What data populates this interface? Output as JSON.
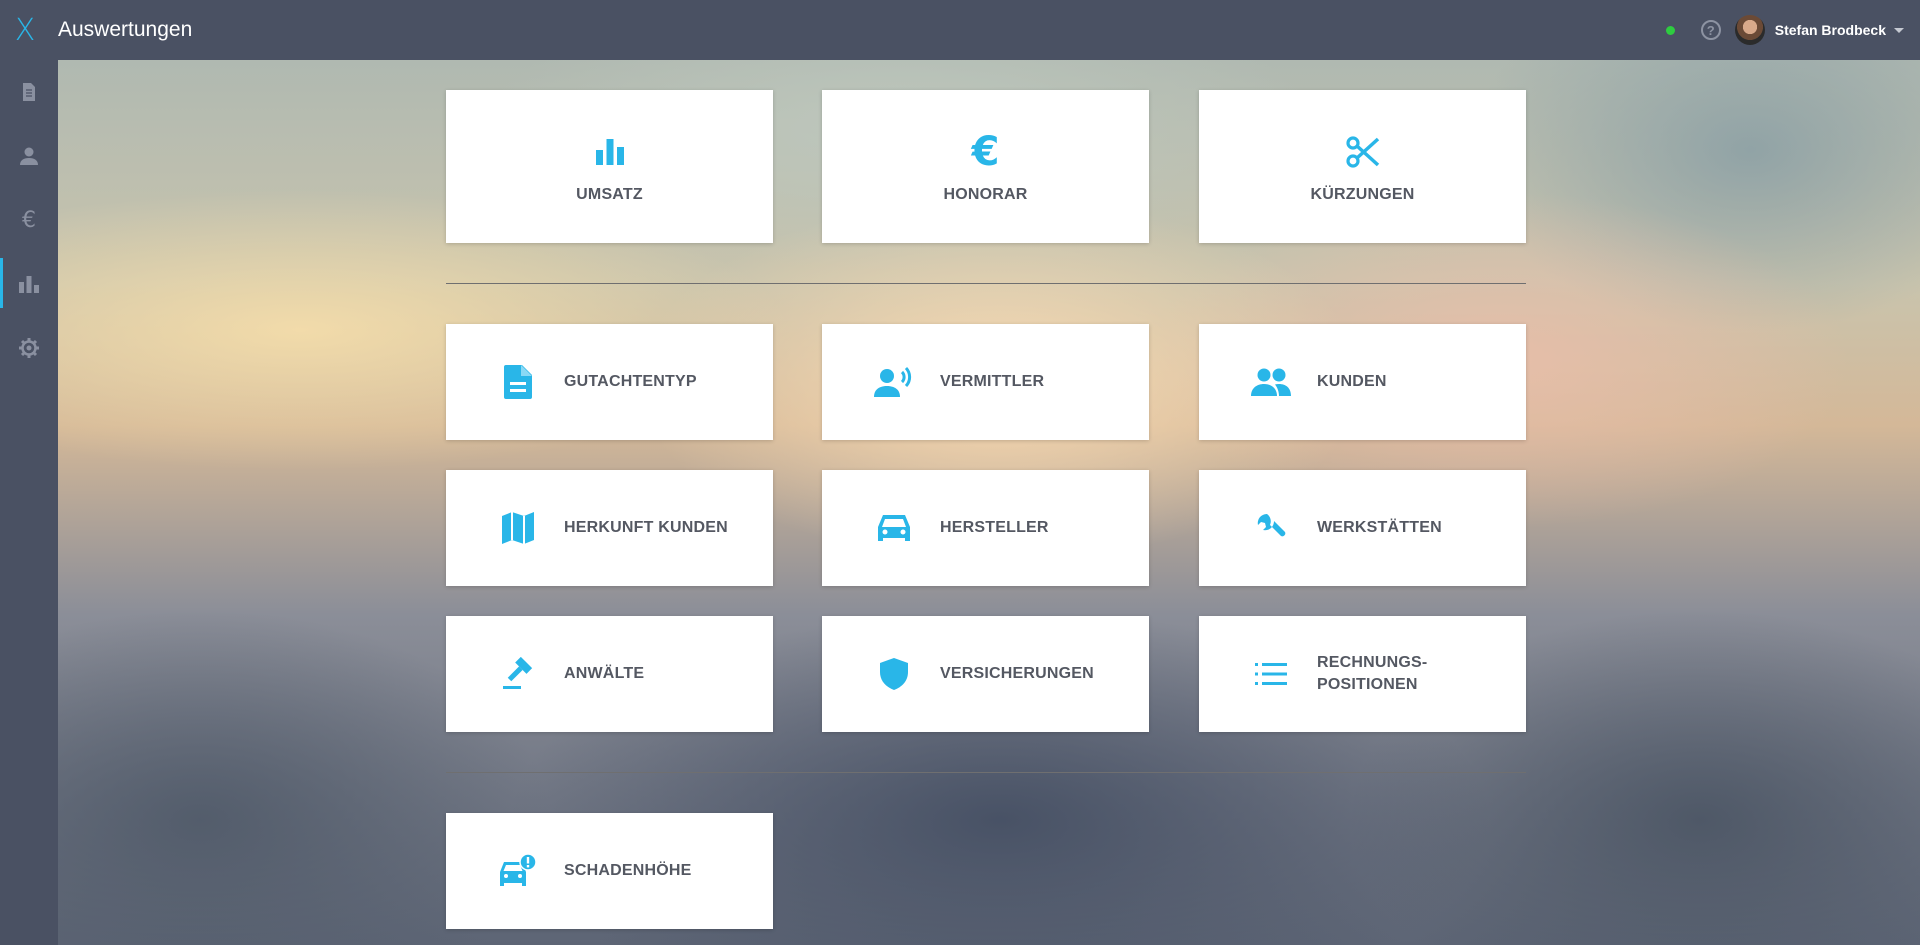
{
  "app": {
    "logo": "X",
    "title": "Auswertungen"
  },
  "header": {
    "status_color": "#2ecc40",
    "help_icon": "?",
    "user_name": "Stefan Brodbeck"
  },
  "sidebar": {
    "items": [
      {
        "icon": "document-icon",
        "active": false
      },
      {
        "icon": "person-icon",
        "active": false
      },
      {
        "icon": "euro-icon",
        "label": "€",
        "active": false
      },
      {
        "icon": "bar-chart-icon",
        "active": true
      },
      {
        "icon": "gear-icon",
        "active": false
      }
    ]
  },
  "colors": {
    "accent": "#29b6e8",
    "topbar": "#4a5163",
    "tile_text": "#545862"
  },
  "tiles": {
    "umsatz": {
      "label": "UMSATZ",
      "icon": "bar-chart-icon"
    },
    "honorar": {
      "label": "HONORAR",
      "icon": "euro-icon",
      "symbol": "€"
    },
    "kuerzungen": {
      "label": "KÜRZUNGEN",
      "icon": "scissors-icon"
    },
    "gutachtentyp": {
      "label": "GUTACHTENTYP",
      "icon": "document-icon"
    },
    "vermittler": {
      "label": "VERMITTLER",
      "icon": "person-voice-icon"
    },
    "kunden": {
      "label": "KUNDEN",
      "icon": "people-icon"
    },
    "herkunft_kunden": {
      "label": "HERKUNFT KUNDEN",
      "icon": "map-icon"
    },
    "hersteller": {
      "label": "HERSTELLER",
      "icon": "car-icon"
    },
    "werkstaetten": {
      "label": "WERKSTÄTTEN",
      "icon": "wrench-icon"
    },
    "anwaelte": {
      "label": "ANWÄLTE",
      "icon": "gavel-icon"
    },
    "versicherungen": {
      "label": "VERSICHERUNGEN",
      "icon": "shield-icon"
    },
    "rechnungs_positionen": {
      "label_line1": "RECHNUNGS-",
      "label_line2": "POSITIONEN",
      "icon": "list-icon"
    },
    "schadenhoehe": {
      "label": "SCHADENHÖHE",
      "icon": "car-alert-icon"
    }
  }
}
